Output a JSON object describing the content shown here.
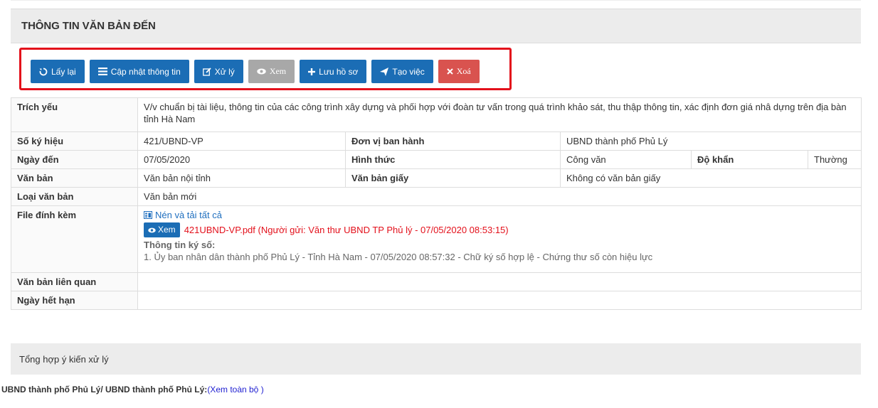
{
  "panel": {
    "title": "THÔNG TIN VĂN BẢN ĐẾN"
  },
  "toolbar": {
    "reload_label": "Lấy lại",
    "update_label": "Cập nhật thông tin",
    "process_label": "Xử lý",
    "view_label": "Xem",
    "save_file_label": "Lưu hồ sơ",
    "create_task_label": "Tạo việc",
    "delete_label": "Xoá"
  },
  "colors": {
    "primary": "#1b6db5",
    "grey": "#a8a8a8",
    "danger": "#d9534f",
    "highlight": "#e3101b"
  },
  "info": {
    "trich_yeu": {
      "label": "Trích yếu",
      "value": "V/v chuẩn bị tài liệu, thông tin của các công trình xây dựng và phối hợp với đoàn tư vấn trong quá trình khảo sát, thu thập thông tin, xác định đơn giá nhâ dựng trên địa bàn tỉnh Hà Nam"
    },
    "so_ky_hieu": {
      "label": "Số ký hiệu",
      "value": "421/UBND-VP"
    },
    "don_vi": {
      "label": "Đơn vị ban hành",
      "value": "UBND thành phố Phủ Lý"
    },
    "ngay_den": {
      "label": "Ngày đến",
      "value": "07/05/2020"
    },
    "hinh_thuc": {
      "label": "Hình thức",
      "value": "Công văn"
    },
    "do_khan": {
      "label": "Độ khẩn",
      "value": "Thường"
    },
    "van_ban": {
      "label": "Văn bản",
      "value": "Văn bản nội tỉnh"
    },
    "van_ban_giay": {
      "label": "Văn bản giấy",
      "value": "Không có văn bản giấy"
    },
    "loai_van_ban": {
      "label": "Loại văn bản",
      "value": "Văn bản mới"
    },
    "file_dinh_kem": {
      "label": "File đính kèm",
      "zip_link": "Nén và tải tất cả",
      "view_button": "Xem",
      "file_text": "421UBND-VP.pdf (Người gửi: Văn thư UBND TP Phủ lý - 07/05/2020 08:53:15)",
      "sig_title": "Thông tin ký số:",
      "sig_line": "1. Ủy ban nhân dân thành phố Phủ Lý - Tỉnh Hà Nam - 07/05/2020 08:57:32 - Chữ ký số hợp lệ - Chứng thư số còn hiệu lực"
    },
    "van_ban_lien_quan": {
      "label": "Văn bản liên quan",
      "value": ""
    },
    "ngay_het_han": {
      "label": "Ngày hết hạn",
      "value": ""
    }
  },
  "summary": {
    "title": "Tổng hợp ý kiến xử lý",
    "org_line": "UBND thành phố Phủ Lý/ UBND thành phố Phủ Lý:",
    "view_all_link": "(Xem toàn bộ )"
  }
}
